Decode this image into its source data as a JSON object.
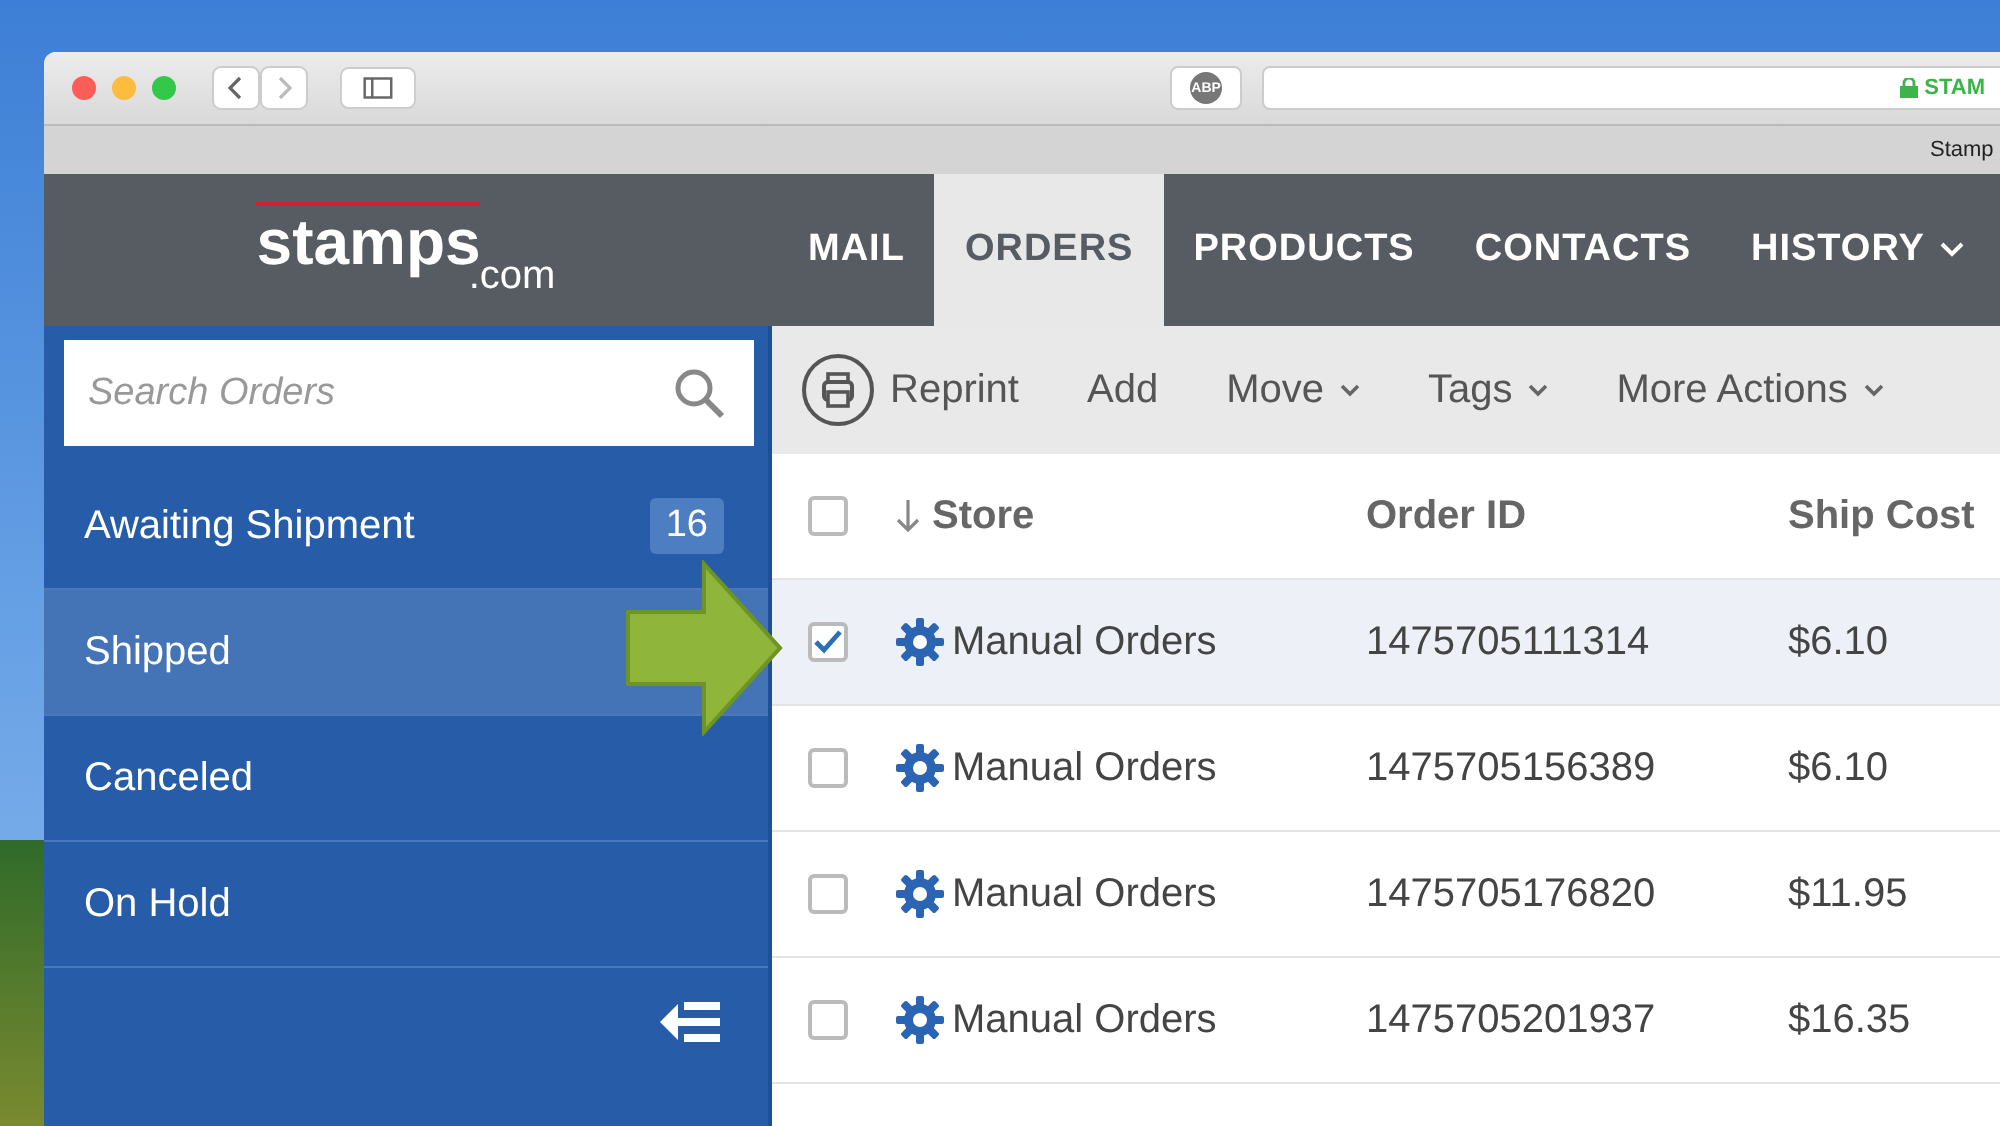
{
  "browser": {
    "adblock_badge": "ABP",
    "address_text": "STAM",
    "tab_title": "Stamp"
  },
  "logo": {
    "word": "stamps",
    "suffix": ".com"
  },
  "nav": [
    {
      "label": "MAIL",
      "selected": false,
      "dropdown": false
    },
    {
      "label": "ORDERS",
      "selected": true,
      "dropdown": false
    },
    {
      "label": "PRODUCTS",
      "selected": false,
      "dropdown": false
    },
    {
      "label": "CONTACTS",
      "selected": false,
      "dropdown": false
    },
    {
      "label": "HISTORY",
      "selected": false,
      "dropdown": true
    }
  ],
  "search": {
    "placeholder": "Search Orders"
  },
  "sidebar": {
    "items": [
      {
        "label": "Awaiting Shipment",
        "count": "16",
        "selected": false
      },
      {
        "label": "Shipped",
        "selected": true
      },
      {
        "label": "Canceled",
        "selected": false
      },
      {
        "label": "On Hold",
        "selected": false
      }
    ]
  },
  "toolbar": [
    {
      "label": "Reprint",
      "kind": "icon"
    },
    {
      "label": "Add",
      "kind": "plain"
    },
    {
      "label": "Move",
      "kind": "menu"
    },
    {
      "label": "Tags",
      "kind": "menu"
    },
    {
      "label": "More Actions",
      "kind": "menu"
    }
  ],
  "table": {
    "header_checked": false,
    "columns": [
      {
        "label": "Store",
        "sorted": true
      },
      {
        "label": "Order ID",
        "sorted": false
      },
      {
        "label": "Ship Cost",
        "sorted": false
      }
    ],
    "rows": [
      {
        "checked": true,
        "store": "Manual Orders",
        "order_id": "1475705111314",
        "ship_cost": "$6.10"
      },
      {
        "checked": false,
        "store": "Manual Orders",
        "order_id": "1475705156389",
        "ship_cost": "$6.10"
      },
      {
        "checked": false,
        "store": "Manual Orders",
        "order_id": "1475705176820",
        "ship_cost": "$11.95"
      },
      {
        "checked": false,
        "store": "Manual Orders",
        "order_id": "1475705201937",
        "ship_cost": "$16.35"
      }
    ]
  }
}
